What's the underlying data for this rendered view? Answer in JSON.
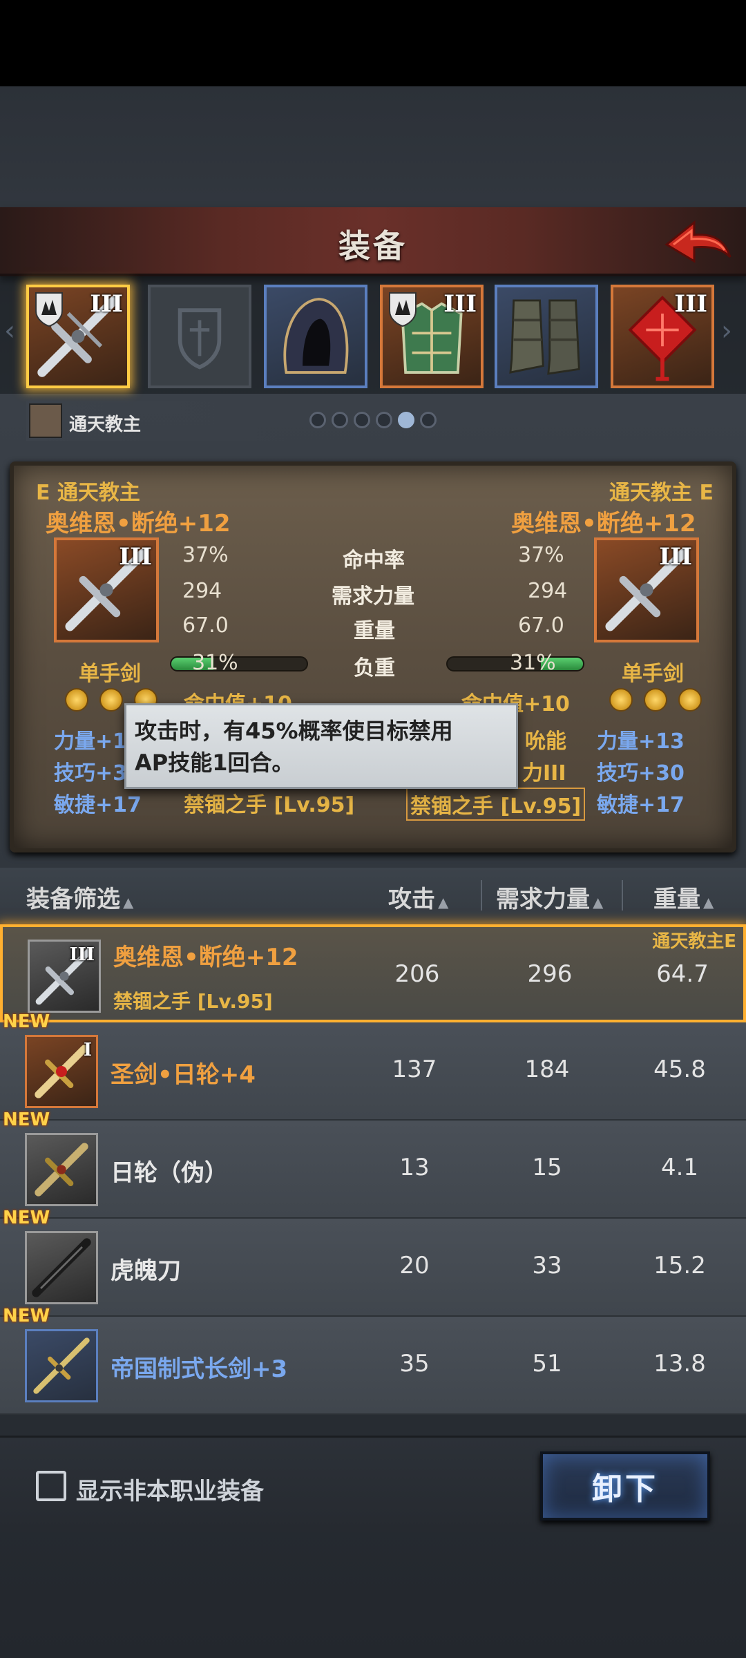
{
  "header": {
    "title": "装备"
  },
  "slots": [
    {
      "rank": "III",
      "state": "selected"
    },
    {
      "rank": "",
      "state": "empty"
    },
    {
      "rank": "",
      "state": "blue"
    },
    {
      "rank": "III",
      "state": "orange"
    },
    {
      "rank": "",
      "state": "blue"
    },
    {
      "rank": "III",
      "state": "orange"
    }
  ],
  "owner": {
    "name": "通天教主",
    "page_count": 6,
    "active_page": 5
  },
  "compare": {
    "left": {
      "owner_tag": "E 通天教主",
      "item_name": "奥维恩•断绝+12",
      "rank": "III",
      "type": "单手剑",
      "hit_rate": "37%",
      "req_str": "294",
      "weight": "67.0",
      "load": "31%",
      "load_fraction": 0.31,
      "hit_value": "命中值+10",
      "str_bonus": "力量+13",
      "dex_bonus": "技巧+30",
      "agi_bonus": "敏捷+17",
      "skill": "禁锢之手 [Lv.95]"
    },
    "right": {
      "owner_tag": "通天教主 E",
      "item_name": "奥维恩•断绝+12",
      "rank": "III",
      "type": "单手剑",
      "hit_rate": "37%",
      "req_str": "294",
      "weight": "67.0",
      "load": "31%",
      "load_fraction": 0.31,
      "hit_value": "命中值+10",
      "extra1": "吮能",
      "extra2": "力III",
      "str_bonus": "力量+13",
      "dex_bonus": "技巧+30",
      "agi_bonus": "敏捷+17",
      "skill": "禁锢之手 [Lv.95]"
    },
    "labels": {
      "hit_rate": "命中率",
      "req_str": "需求力量",
      "weight": "重量",
      "load": "负重"
    },
    "partial_left": {
      "str": "力量+1",
      "dex": "技巧+3",
      "agi": "敏捷+17"
    }
  },
  "tooltip": {
    "line1": "攻击时，有45%概率使目标禁用",
    "line2": "AP技能1回合。"
  },
  "list": {
    "headers": {
      "filter": "装备筛选",
      "attack": "攻击",
      "req_str": "需求力量",
      "weight": "重量"
    },
    "rows": [
      {
        "name": "奥维恩•断绝+12",
        "sub": "禁锢之手 [Lv.95]",
        "owner": "通天教主E",
        "rank": "III",
        "attack": "206",
        "req_str": "296",
        "weight": "64.7",
        "is_new": false,
        "selected": true,
        "frame": "gray"
      },
      {
        "name": "圣剑•日轮+4",
        "new_label": "NEW",
        "rank": "I",
        "attack": "137",
        "req_str": "184",
        "weight": "45.8",
        "is_new": true,
        "frame": "orange"
      },
      {
        "name": "日轮（伪）",
        "new_label": "NEW",
        "attack": "13",
        "req_str": "15",
        "weight": "4.1",
        "is_new": true,
        "frame": "gray"
      },
      {
        "name": "虎魄刀",
        "new_label": "NEW",
        "attack": "20",
        "req_str": "33",
        "weight": "15.2",
        "is_new": true,
        "frame": "gray"
      },
      {
        "name": "帝国制式长剑+3",
        "new_label": "NEW",
        "attack": "35",
        "req_str": "51",
        "weight": "13.8",
        "is_new": true,
        "frame": "blue"
      }
    ]
  },
  "bottom": {
    "checkbox_label": "显示非本职业装备",
    "unequip_label": "卸下"
  },
  "colors": {
    "accent_orange": "#d5783a",
    "accent_blue": "#5b7fbf",
    "selected_glow": "#ffb030",
    "name_gold": "#e8b646",
    "stat_blue": "#7aa8ee"
  }
}
